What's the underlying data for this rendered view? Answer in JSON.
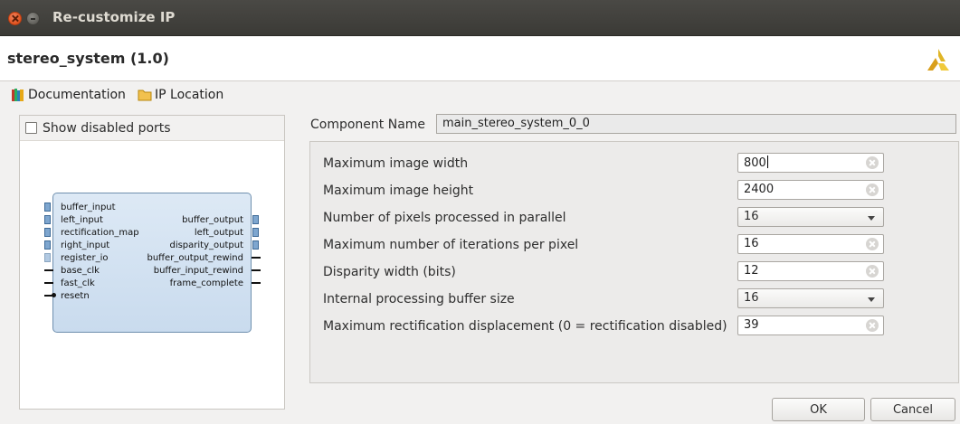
{
  "window": {
    "title": "Re-customize IP",
    "close_icon": "close-icon",
    "minimize_icon": "minimize-icon"
  },
  "header": {
    "ip_title": "stereo_system (1.0)",
    "logo": "xilinx-logo"
  },
  "links": {
    "documentation": "Documentation",
    "ip_location": "IP Location"
  },
  "left_panel": {
    "show_disabled_ports": "Show disabled ports",
    "block": {
      "left_ports": [
        "buffer_input",
        "left_input",
        "rectification_map",
        "right_input",
        "register_io",
        "base_clk",
        "fast_clk",
        "resetn"
      ],
      "right_ports": [
        "buffer_output",
        "left_output",
        "disparity_output",
        "buffer_output_rewind",
        "buffer_input_rewind",
        "frame_complete"
      ]
    }
  },
  "component": {
    "label": "Component Name",
    "value": "main_stereo_system_0_0"
  },
  "params": [
    {
      "label": "Maximum image width",
      "value": "800",
      "kind": "input"
    },
    {
      "label": "Maximum image height",
      "value": "2400",
      "kind": "input"
    },
    {
      "label": "Number of pixels processed in parallel",
      "value": "16",
      "kind": "select"
    },
    {
      "label": "Maximum number of iterations per pixel",
      "value": "16",
      "kind": "input"
    },
    {
      "label": "Disparity width (bits)",
      "value": "12",
      "kind": "input"
    },
    {
      "label": "Internal processing buffer size",
      "value": "16",
      "kind": "select"
    },
    {
      "label": "Maximum rectification displacement (0 = rectification disabled)",
      "value": "39",
      "kind": "input"
    }
  ],
  "buttons": {
    "ok": "OK",
    "cancel": "Cancel"
  }
}
